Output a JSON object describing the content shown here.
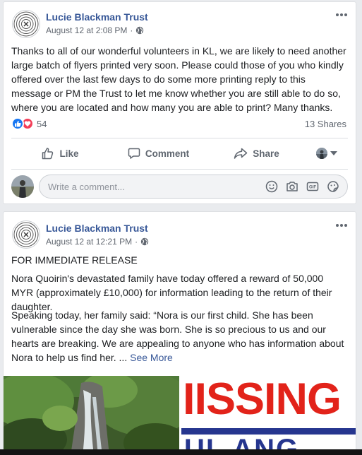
{
  "post1": {
    "page_name": "Lucie Blackman Trust",
    "timestamp": "August 12 at 2:08 PM",
    "separator": "·",
    "text": "Thanks to all of our wonderful volunteers in KL, we are likely to need another large batch of flyers printed very soon. Please could those of you who kindly offered over the last few days to do some more printing reply to this message or PM the Trust to let me know whether you are still able to do so, where you are located and how many you are able to print? Many thanks.",
    "reaction_count": "54",
    "shares": "13 Shares",
    "actions": {
      "like": "Like",
      "comment": "Comment",
      "share": "Share"
    },
    "comment_placeholder": "Write a comment..."
  },
  "post2": {
    "page_name": "Lucie Blackman Trust",
    "timestamp": "August 12 at 12:21 PM",
    "separator": "·",
    "headline": "FOR IMMEDIATE RELEASE",
    "para1": "Nora Quoirin's devastated family have today offered a reward of 50,000 MYR (approximately £10,000) for information leading to the return of their daughter.",
    "para2": "Speaking today, her family said: “Nora is our first child. She has been vulnerable since the day she was born. She is so precious to us and our hearts are breaking. We are appealing to anyone who has information about Nora to help us find her. ...",
    "see_more": "See More",
    "poster_text": "IISSING",
    "poster_text2": "UL ANG"
  },
  "colors": {
    "link": "#385898",
    "like": "#1877f2",
    "love": "#f33e58",
    "poster_red": "#e2231a",
    "poster_blue": "#26368f"
  }
}
